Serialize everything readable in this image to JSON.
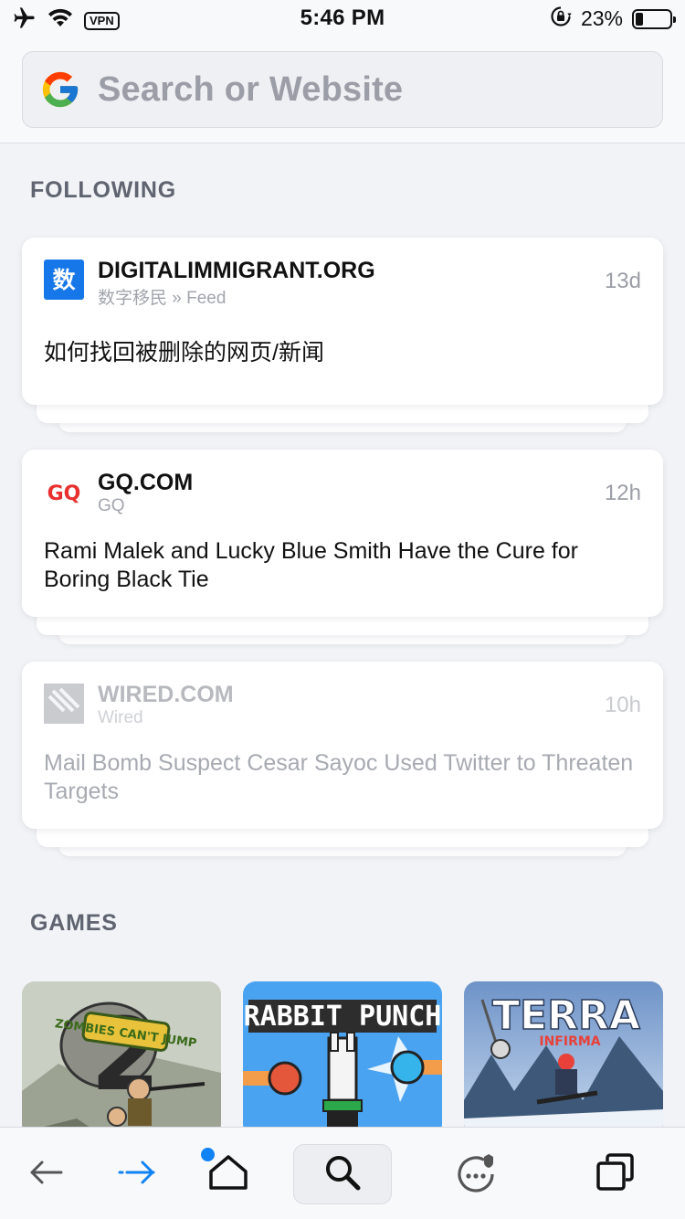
{
  "status_bar": {
    "time": "5:46 PM",
    "vpn_label": "VPN",
    "battery_percent": "23%",
    "battery_level": 0.23,
    "icons": [
      "airplane-icon",
      "wifi-icon",
      "rotation-lock-icon",
      "battery-icon"
    ]
  },
  "search": {
    "placeholder": "Search or Website",
    "engine_icon": "google-icon"
  },
  "sections": {
    "following": "FOLLOWING",
    "games": "GAMES"
  },
  "feed": [
    {
      "source": "DIGITALIMMIGRANT.ORG",
      "sub": "数字移民 » Feed",
      "time": "13d",
      "title": "如何找回被删除的网页/新闻",
      "logo_text": "数",
      "logo_color": "#1677e8"
    },
    {
      "source": "GQ.COM",
      "sub": "GQ",
      "time": "12h",
      "title": "Rami Malek and Lucky Blue Smith Have the Cure for Boring Black Tie",
      "logo_text": "GQ",
      "logo_color": "#e8312f"
    },
    {
      "source": "WIRED.COM",
      "sub": "Wired",
      "time": "10h",
      "title": "Mail Bomb Suspect Cesar Sayoc Used Twitter to Threaten Targets",
      "logo_color": "#b9bbc0"
    }
  ],
  "games": [
    {
      "name": "ZOMBIES CAN'T JUMP",
      "number": "2",
      "theme_color": "#7f8b6a"
    },
    {
      "name": "RABBIT PUNCH",
      "theme_color": "#2f8de6"
    },
    {
      "name": "TERRA",
      "name_line2": "INFIRMA",
      "theme_color": "#8fb0d8"
    }
  ],
  "toolbar": {
    "items": [
      "back-icon",
      "forward-icon",
      "home-icon",
      "search-icon",
      "chat-icon",
      "tabs-icon"
    ],
    "accent": "#1283f5"
  }
}
